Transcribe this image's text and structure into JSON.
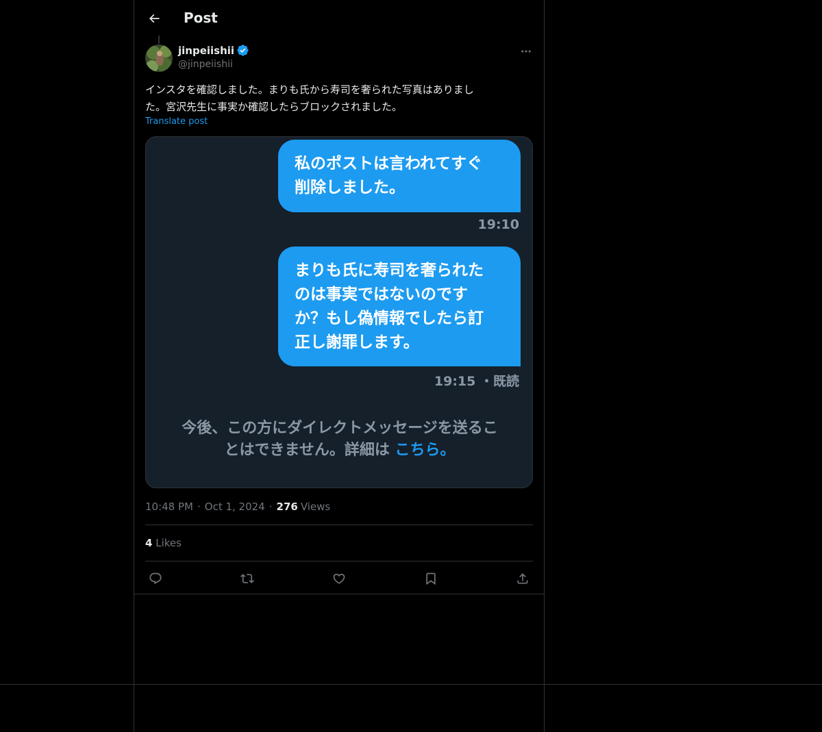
{
  "header": {
    "title": "Post"
  },
  "post": {
    "author": {
      "display_name": "jinpeiishii",
      "handle": "@jinpeiishii",
      "verified": true
    },
    "text_lines": [
      "インスタを確認しました。まりも氏から寿司を奢られた写真はありまし",
      "た。宮沢先生に事実か確認したらブロックされました。"
    ],
    "translate_label": "Translate post",
    "media": {
      "messages": [
        {
          "lines": [
            "私のポストは言われてすぐ",
            "削除しました。"
          ],
          "time": "19:10"
        },
        {
          "lines": [
            "まりも氏に寿司を奢られた",
            "のは事実ではないのです",
            "か？もし偽情報でしたら訂",
            "正し謝罪します。"
          ],
          "time": "19:15 ・既読"
        }
      ],
      "notice_line1": "今後、この方にダイレクトメッセージを送るこ",
      "notice_line2": "とはできません。詳細は",
      "notice_link": "こちら。"
    },
    "time": "10:48 PM",
    "date": "Oct 1, 2024",
    "views_count": "276",
    "views_label": "Views",
    "likes_count": "4",
    "likes_label": "Likes"
  },
  "icons": {
    "back": "arrow-left-icon",
    "more": "more-horizontal-icon",
    "verified": "verified-badge-icon",
    "reply": "reply-icon",
    "repost": "repost-icon",
    "like": "heart-icon",
    "bookmark": "bookmark-icon",
    "share": "share-icon"
  },
  "colors": {
    "background": "#000000",
    "accent": "#1d9bf0",
    "text_primary": "#e7e9ea",
    "text_secondary": "#71767b",
    "border": "#2f3336",
    "dm_background": "#15202b",
    "dm_bubble": "#1d9bf0"
  }
}
